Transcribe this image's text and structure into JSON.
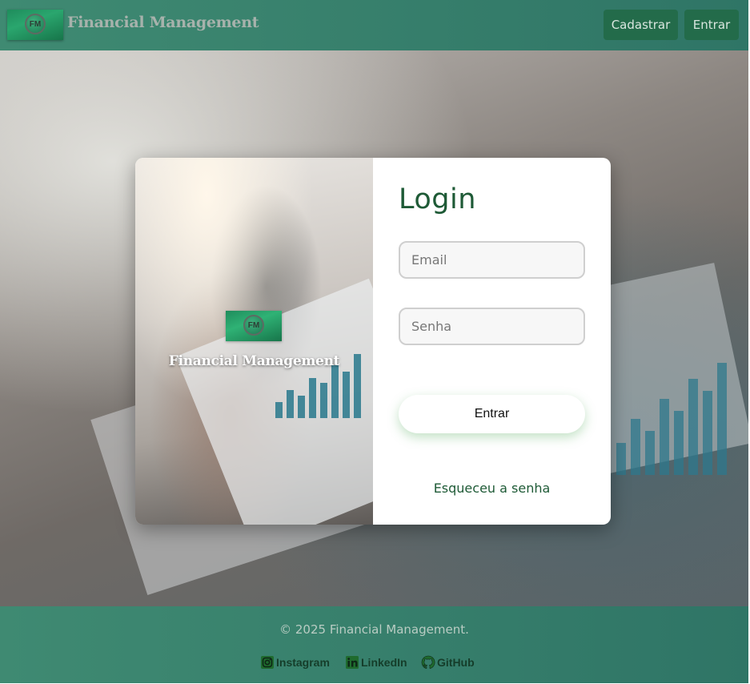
{
  "header": {
    "logo_text": "FM",
    "brand": "Financial Management",
    "buttons": {
      "register": "Cadastrar",
      "login": "Entrar"
    }
  },
  "card": {
    "logo_text": "FM",
    "brand": "Financial Management"
  },
  "form": {
    "title": "Login",
    "email_placeholder": "Email",
    "password_placeholder": "Senha",
    "submit_label": "Entrar",
    "forgot_label": "Esqueceu a senha"
  },
  "footer": {
    "copyright": "© 2025 Financial Management.",
    "links": [
      {
        "label": "Instagram",
        "icon": "instagram-icon"
      },
      {
        "label": "LinkedIn",
        "icon": "linkedin-icon"
      },
      {
        "label": "GitHub",
        "icon": "github-icon"
      }
    ]
  },
  "colors": {
    "header_bg": "#3f8a72",
    "accent_green": "#1e5a36",
    "button_bg": "#236b4a"
  }
}
